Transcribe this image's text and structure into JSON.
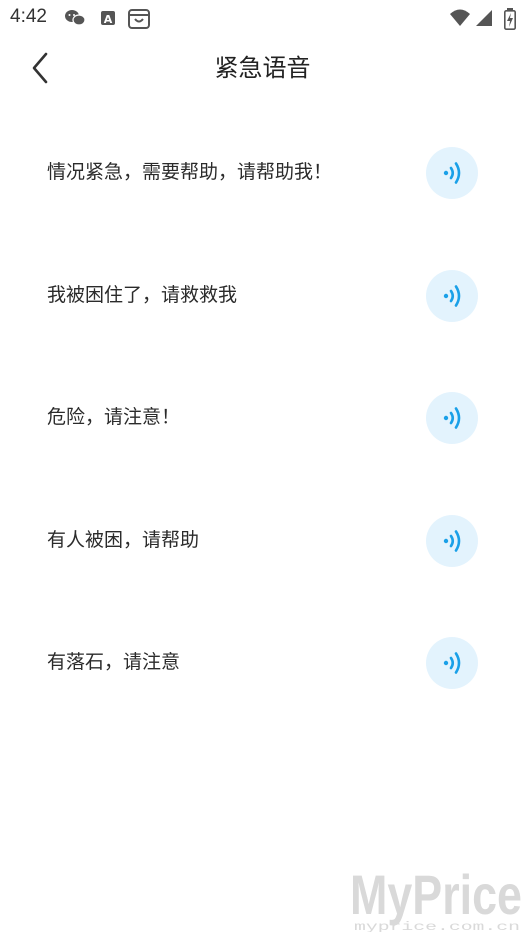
{
  "status_bar": {
    "time": "4:42",
    "left_icons": [
      "wechat-icon",
      "font-a-icon",
      "store-bag-icon"
    ],
    "right_icons": [
      "wifi-icon",
      "cell-signal-icon",
      "battery-charging-icon"
    ]
  },
  "header": {
    "back_icon": "chevron-left-icon",
    "title": "紧急语音"
  },
  "phrases": [
    {
      "text": "情况紧急，需要帮助，请帮助我！",
      "icon": "speaker-wave-icon"
    },
    {
      "text": "我被困住了，请救救我",
      "icon": "speaker-wave-icon"
    },
    {
      "text": "危险，请注意！",
      "icon": "speaker-wave-icon"
    },
    {
      "text": "有人被困，请帮助",
      "icon": "speaker-wave-icon"
    },
    {
      "text": "有落石，请注意",
      "icon": "speaker-wave-icon"
    }
  ],
  "watermark": {
    "main": "MyPrice",
    "sub": "myprice.com.cn"
  },
  "colors": {
    "accent": "#1aa0e8",
    "play_bg": "#e3f3fd",
    "text": "#2b2b2b"
  }
}
